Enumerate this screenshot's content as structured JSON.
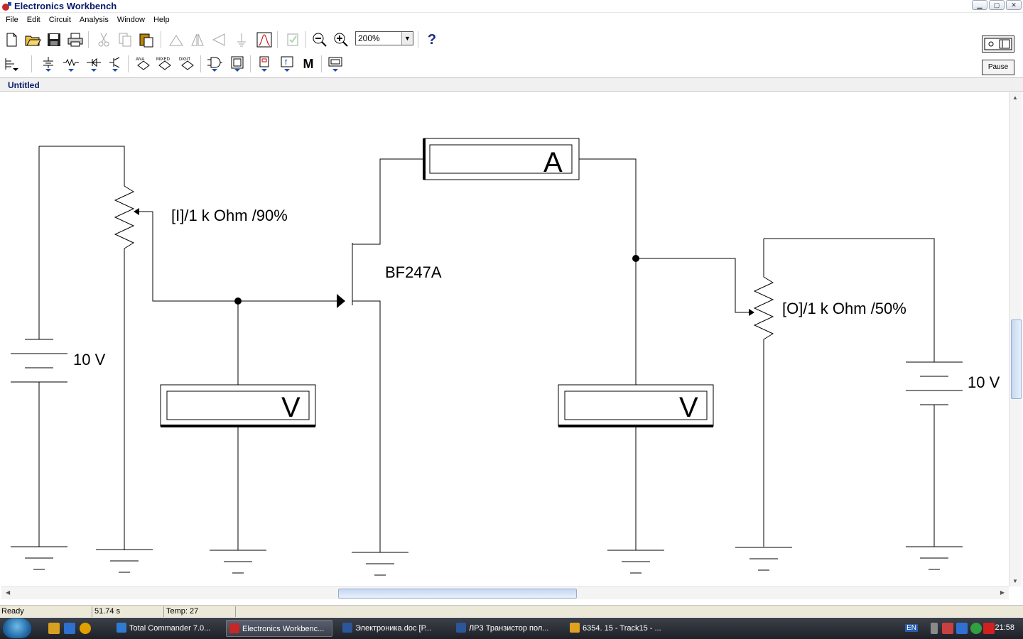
{
  "window": {
    "title": "Electronics Workbench",
    "controls": [
      "minimize",
      "maximize",
      "close"
    ]
  },
  "menu": {
    "items": [
      "File",
      "Edit",
      "Circuit",
      "Analysis",
      "Window",
      "Help"
    ]
  },
  "toolbar": {
    "zoom_value": "200%",
    "help_label": "?",
    "row1_icons": [
      "new-file-icon",
      "open-folder-icon",
      "save-icon",
      "print-icon",
      "cut-icon",
      "copy-icon",
      "paste-icon",
      "rotate-icon",
      "flip-horizontal-icon",
      "flip-vertical-icon",
      "subcircuit-icon",
      "graph-icon",
      "component-properties-icon",
      "zoom-out-icon",
      "zoom-in-icon"
    ],
    "row2": {
      "ana_label": "ANA",
      "mixed_label": "MIXED",
      "digit_label": "DIGIT",
      "misc_label": "M"
    }
  },
  "simulation": {
    "pause_label": "Pause"
  },
  "document": {
    "title": "Untitled"
  },
  "circuit": {
    "source_left_label": "10 V",
    "source_right_label": "10 V",
    "pot_input_label": "[I]/1 k Ohm /90%",
    "pot_output_label": "[O]/1 k Ohm /50%",
    "transistor_label": "BF247A",
    "ammeter_symbol": "A",
    "voltmeter_left_symbol": "V",
    "voltmeter_right_symbol": "V"
  },
  "status": {
    "state": "Ready",
    "time": "51.74 s",
    "temp": "Temp:  27"
  },
  "taskbar": {
    "tasks": [
      {
        "label": "Total Commander 7.0...",
        "active": false,
        "color": "#2e7bd1"
      },
      {
        "label": "Electronics Workbenc...",
        "active": true,
        "color": "#c62828"
      },
      {
        "label": "Электроника.doc [Р...",
        "active": false,
        "color": "#2b579a"
      },
      {
        "label": "ЛР3 Транзистор пол...",
        "active": false,
        "color": "#2b579a"
      },
      {
        "label": "6354. 15 - Track15 - ...",
        "active": false,
        "color": "#e0a020"
      }
    ],
    "language": "EN",
    "clock": "21:58"
  }
}
